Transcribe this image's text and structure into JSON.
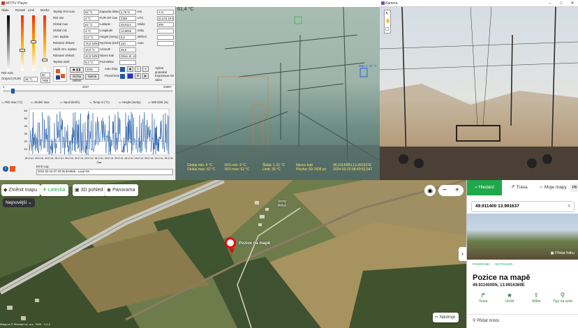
{
  "player": {
    "title": "MOTIV Player",
    "sliders": [
      {
        "label": "Škála",
        "top": "100",
        "bottom": "0"
      },
      {
        "label": "Rozsah",
        "top": "(%)",
        "bottom": ""
      },
      {
        "label": "Limit",
        "top": "(%)",
        "bottom": ""
      },
      {
        "label": "Mocha",
        "top": "(%)",
        "bottom": ""
      }
    ],
    "roi_auto": "ROI Auto",
    "grayscale": "GrayScl (FLIR)",
    "offset_val": "36 °C",
    "num_a": "50",
    "num_b": "7609",
    "fields_left": [
      {
        "label": "Teploty",
        "sub": "ROI max",
        "value": "62 °C"
      },
      {
        "label": "",
        "sub": "ROI min",
        "value": "4 °C"
      },
      {
        "label": "",
        "sub": "Global max",
        "value": "62 °C"
      },
      {
        "label": "",
        "sub": "Global min",
        "value": "4 °C"
      },
      {
        "label": "",
        "sub": "Atm. teplota",
        "value": "2,0 °C"
      },
      {
        "label": "",
        "sub": "Relativní vlhkost",
        "value": "78,0 %RH"
      },
      {
        "label": "Uložit",
        "sub": "Atm. teplota",
        "value": "10,0 °C"
      },
      {
        "label": "",
        "sub": "Relativní vlhkost",
        "value": "42,0 %RH"
      },
      {
        "label": "",
        "sub": "Teplota okolí",
        "value": "5,0 °C"
      }
    ],
    "fields_mid": [
      {
        "label": "Kapacita disku",
        "value": "2,76 %"
      },
      {
        "label": "FLIR GP Cas",
        "value": "2394"
      },
      {
        "label": "Latitude",
        "value": "49,9114"
      },
      {
        "label": "Longitude",
        "value": "13,9916"
      },
      {
        "label": "Height (metry)",
        "value": "0,0"
      },
      {
        "label": "Rychlost (km/h)",
        "value": "110"
      },
      {
        "label": "Azimuth",
        "value": "45,0"
      },
      {
        "label": "Název trati",
        "value": "Zdice-Zr.-ovan-Beroun"
      },
      {
        "label": "Poznámka",
        "value": ""
      }
    ],
    "fields_right": [
      {
        "label": "Km",
        "value": "1 m"
      },
      {
        "label": "UTC",
        "value": "(0,4,0)\n19.03.2024"
      },
      {
        "label": "Skála",
        "value": "IRN"
      },
      {
        "label": "Ksky",
        "value": ""
      },
      {
        "label": "Měření",
        "value": ""
      },
      {
        "label": "Auto",
        "value": ""
      }
    ],
    "zoom_value": "200x",
    "auto_stop": "Auto Stop",
    "presets": "Preset limit",
    "nahrat": "Nahrát",
    "vybrat": "Vybrat groteskul",
    "exportovat": "Exportovat AVI video",
    "stop_label": "Složka měření",
    "timeline": {
      "start": "1",
      "mid": "2047",
      "end": "24507"
    },
    "legend": [
      "ROI max (°C)",
      "Globní max",
      "Spod (km/h)",
      "Temp m (°C)",
      "Height (metry)",
      "500 Disk (%)"
    ],
    "chart_y": [
      "60",
      "50",
      "40",
      "30",
      "20",
      "10"
    ],
    "x_ticks": [
      "09:17:41",
      "09:17:41",
      "09:17:41",
      "09:17:41",
      "09:17:41",
      "09:17:41",
      "09:17:41",
      "09:17:41",
      "09:17:41",
      "09:17:41",
      "09:17:41",
      "09:17:41",
      "09:17:41",
      "09:17:41",
      "09:17:41"
    ],
    "x_title": "Čas",
    "error_log": "Error Log",
    "error_text": "2024-03-19 07:20:35.904856 - Load OK"
  },
  "thermal": {
    "temp_top": "61,4 °C",
    "box_label": "Max 2: 61 °C",
    "info_col1": [
      "Global min: 4 °C",
      "Global max: 62 °C"
    ],
    "info_col2": [
      "ROI min: 4 °C",
      "ROI max: 62 °C"
    ],
    "info_col3": [
      "Škála: 1-31 °C",
      "Limit: 36 °C"
    ],
    "info_col4": [
      "Název trati",
      "Plocha: 50-7609 px"
    ],
    "info_col5": [
      "49,911400N,13,991637E",
      "2024-03-19 08:40:52,547"
    ]
  },
  "camera": {
    "title": "Kamera",
    "tools": [
      "↖",
      "✋",
      "▢"
    ]
  },
  "map": {
    "tabs": [
      {
        "icon": "layers-icon",
        "glyph": "◆",
        "label": "Změnit mapu"
      },
      {
        "icon": "plane-icon",
        "glyph": "✈",
        "label": "Letecká"
      },
      {
        "icon": "cube-icon",
        "glyph": "▣",
        "label": "3D pohled"
      },
      {
        "icon": "eye-icon",
        "glyph": "◉",
        "label": "Panorama"
      }
    ],
    "newest": "Nejnovější",
    "pin_label": "Pozice na mapě",
    "place_label": "Vrchy\nBěleč",
    "tools_label": "Nástroje",
    "copyright": "Mapy.cz © Seznam.cz, a.s., 2024 · 1,1,2"
  },
  "panel": {
    "tabs": [
      {
        "icon": "search-icon",
        "glyph": "⌕",
        "label": "Hledání"
      },
      {
        "icon": "route-icon",
        "glyph": "↱",
        "label": "Trasa"
      },
      {
        "icon": "star-icon",
        "glyph": "☆",
        "label": "Moje mapy"
      }
    ],
    "extra_tab": "PB",
    "search_value": "49.911400 13.991637",
    "photo_label": "Přidat fotku",
    "tags": [
      "PANORAMA",
      "3D POHLED"
    ],
    "place_title": "Pozice na mapě",
    "coords": "49.9114000N, 13.9916369E",
    "actions": [
      {
        "icon": "route-action-icon",
        "glyph": "↱",
        "label": "Trasa"
      },
      {
        "icon": "save-icon",
        "glyph": "★",
        "label": "Uložit"
      },
      {
        "icon": "share-icon",
        "glyph": "⇪",
        "label": "Sdílet"
      },
      {
        "icon": "trip-icon",
        "glyph": "⚲",
        "label": "Tipy na výlet"
      }
    ],
    "add_place": "Přidat místo"
  },
  "colors": {
    "map_green": "#1ea84a",
    "chart_blue": "#1f5aa6",
    "thermal_bg": "#9fb6ad"
  }
}
